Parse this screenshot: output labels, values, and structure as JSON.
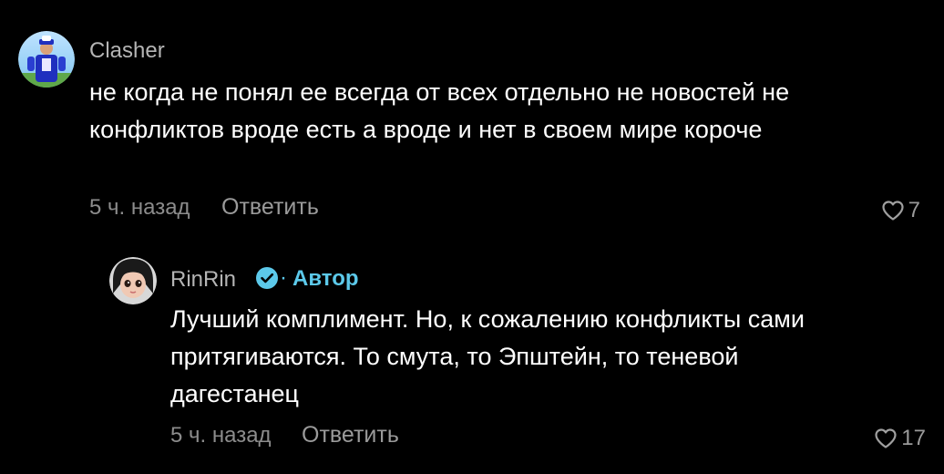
{
  "comments": [
    {
      "username": "Clasher",
      "text": "не когда не понял ее всегда от всех отдельно не новостей не конфликтов вроде есть а вроде и нет в своем мире короче",
      "time": "5 ч. назад",
      "reply_label": "Ответить",
      "likes": "7",
      "avatar_icon": "user-avatar-blue-figure"
    },
    {
      "username": "RinRin",
      "verified": true,
      "separator": "·",
      "author_label": "Автор",
      "text": "Лучший комплимент. Но, к сожалению конфликты сами притягиваются. То смута, то Эпштейн, то теневой дагестанец",
      "time": "5 ч. назад",
      "reply_label": "Ответить",
      "likes": "17",
      "avatar_icon": "user-avatar-doll-face"
    }
  ],
  "colors": {
    "background": "#000000",
    "username": "#b5b5b5",
    "body_text": "#ffffff",
    "meta": "#8c8c8c",
    "author_accent": "#5cc9ea"
  }
}
